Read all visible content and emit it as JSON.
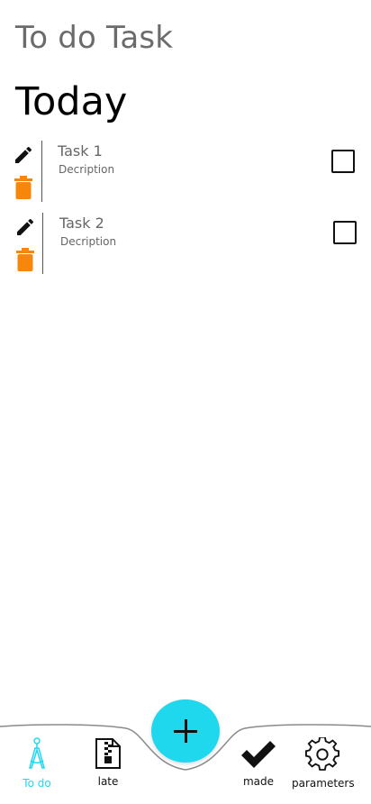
{
  "app": {
    "title": "To do Task"
  },
  "section": {
    "title": "Today"
  },
  "tasks": [
    {
      "name": "Task 1",
      "description": "Decription",
      "done": false
    },
    {
      "name": "Task 2",
      "description": "Decription",
      "done": false
    }
  ],
  "colors": {
    "accent": "#1fd8ee",
    "delete": "#f7870a",
    "text_secondary": "#666666"
  },
  "nav": {
    "items": [
      {
        "label": "To do",
        "icon": "compass-icon",
        "active": true
      },
      {
        "label": "late",
        "icon": "zip-file-icon",
        "active": false
      },
      {
        "label": "made",
        "icon": "checkmark-icon",
        "active": false
      },
      {
        "label": "parameters",
        "icon": "gear-icon",
        "active": false
      }
    ],
    "fab_icon": "plus-icon"
  }
}
